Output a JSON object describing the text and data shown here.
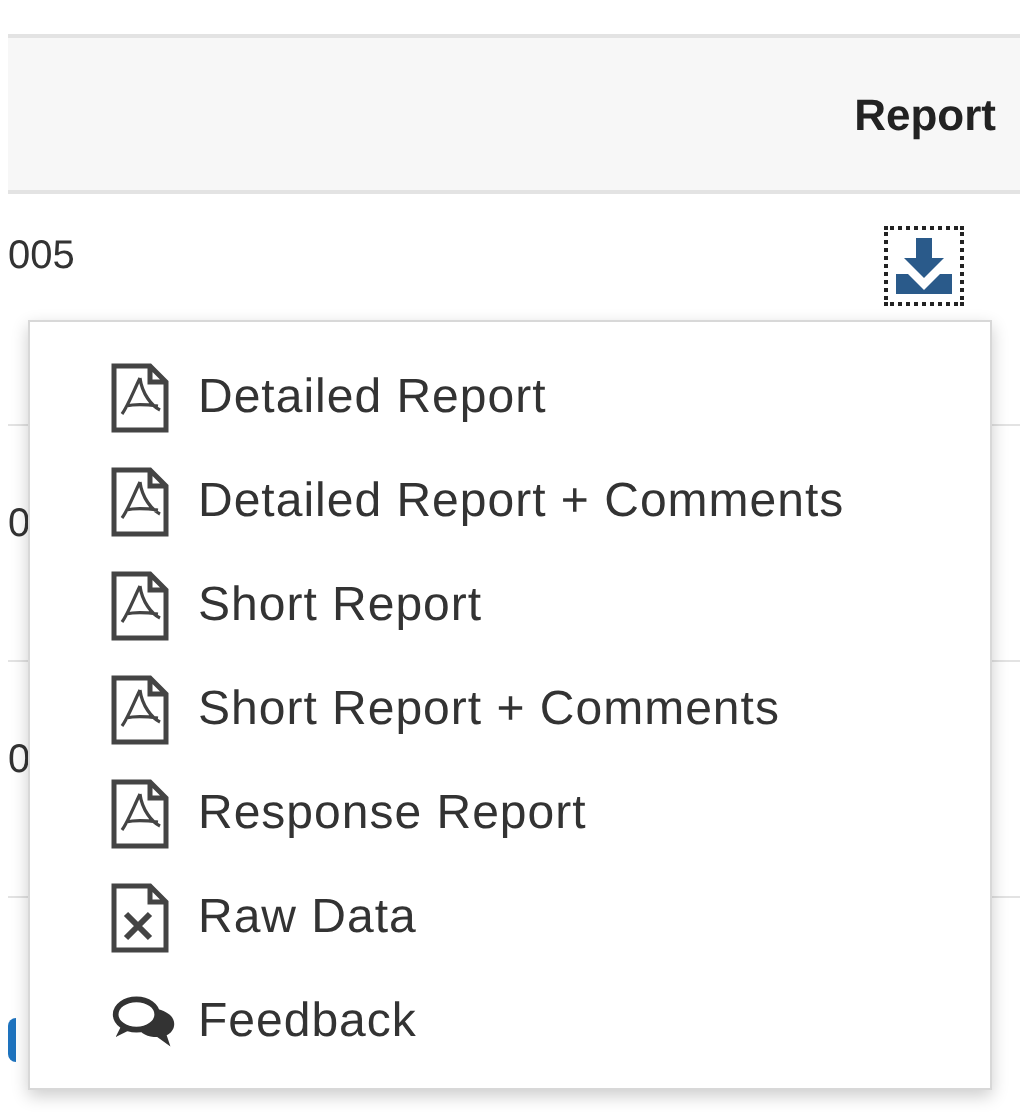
{
  "table": {
    "columns": [
      {
        "label": "Report"
      }
    ],
    "rows": [
      {
        "column_1": "005",
        "has_download": true
      },
      {
        "column_1": "0"
      },
      {
        "column_1": "0"
      }
    ]
  },
  "menu": {
    "items": [
      {
        "kind": "pdf",
        "label": "Detailed Report"
      },
      {
        "kind": "pdf",
        "label": "Detailed Report + Comments"
      },
      {
        "kind": "pdf",
        "label": "Short Report"
      },
      {
        "kind": "pdf",
        "label": "Short Report + Comments"
      },
      {
        "kind": "pdf",
        "label": "Response Report"
      },
      {
        "kind": "excel",
        "label": "Raw Data"
      },
      {
        "kind": "feedback",
        "label": "Feedback"
      }
    ]
  }
}
